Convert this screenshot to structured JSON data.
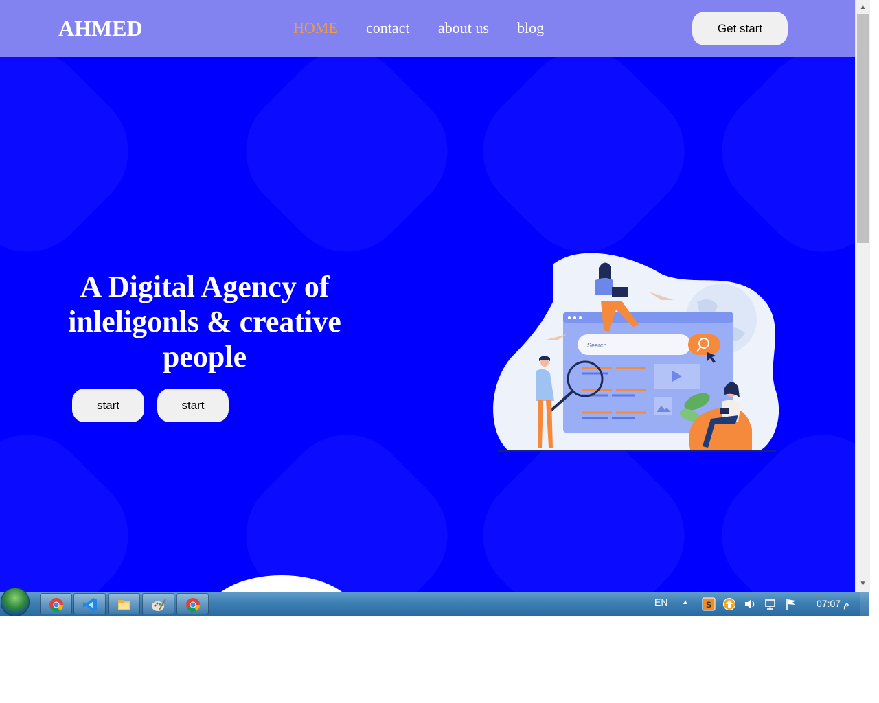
{
  "header": {
    "logo": "AHMED",
    "nav": [
      {
        "label": "HOME",
        "active": true
      },
      {
        "label": "contact",
        "active": false
      },
      {
        "label": "about us",
        "active": false
      },
      {
        "label": "blog",
        "active": false
      }
    ],
    "cta_label": "Get start"
  },
  "hero": {
    "title_line1": "A Digital Agency of",
    "title_line2": "inleligonls & creative",
    "title_line3": "people",
    "buttons": [
      "start",
      "start"
    ],
    "illustration": {
      "search_placeholder": "Search....",
      "icon": "digital-agency-illustration-icon"
    }
  },
  "colors": {
    "header_bg": "#8282f0",
    "hero_bg": "#0000ff",
    "nav_active": "#f59a3c",
    "button_bg": "#f0f0f0"
  },
  "taskbar": {
    "apps": [
      "chrome-icon",
      "vscode-icon",
      "file-explorer-icon",
      "paint-icon",
      "chrome-icon"
    ],
    "language": "EN",
    "clock": "07:07 م"
  }
}
